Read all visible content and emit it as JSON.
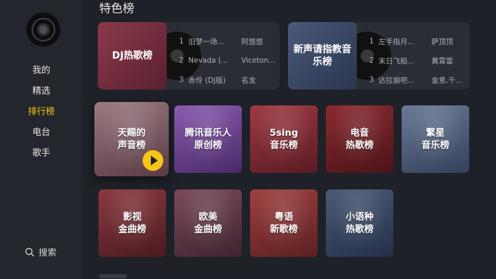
{
  "sidebar": {
    "nav": [
      {
        "label": "我的",
        "active": false
      },
      {
        "label": "精选",
        "active": false
      },
      {
        "label": "排行榜",
        "active": true
      },
      {
        "label": "电台",
        "active": false
      },
      {
        "label": "歌手",
        "active": false
      }
    ],
    "search_label": "搜索"
  },
  "main": {
    "section_title": "特色榜",
    "wide_cards": [
      {
        "title": "DJ热歌榜",
        "rows": [
          {
            "rank": "1",
            "song": "旧梦一场...",
            "artist": "阿悠悠"
          },
          {
            "rank": "2",
            "song": "Nevada (...",
            "artist": "Viceton..."
          },
          {
            "rank": "3",
            "song": "赤伶 (DJ版)",
            "artist": "名龙"
          }
        ]
      },
      {
        "title": "新声请指教音乐榜",
        "rows": [
          {
            "rank": "1",
            "song": "左手指月...",
            "artist": "萨顶顶"
          },
          {
            "rank": "2",
            "song": "末日飞船...",
            "artist": "黄霄雲"
          },
          {
            "rank": "3",
            "song": "达拉崩吧...",
            "artist": "金意,千..."
          }
        ]
      }
    ],
    "tiles_row1": [
      {
        "line1": "天赐的",
        "line2": "声音榜",
        "color": "#7a5a62"
      },
      {
        "line1": "腾讯音乐人",
        "line2": "原创榜",
        "color": "#6a4a8a"
      },
      {
        "line1": "5sing",
        "line2": "音乐榜",
        "color": "#7a2a34"
      },
      {
        "line1": "电音",
        "line2": "热歌榜",
        "color": "#6a2228"
      },
      {
        "line1": "繁星",
        "line2": "音乐榜",
        "color": "#4a5a74"
      }
    ],
    "tiles_row2": [
      {
        "line1": "影视",
        "line2": "金曲榜",
        "color": "#6a2a30"
      },
      {
        "line1": "欧美",
        "line2": "金曲榜",
        "color": "#5a3a4a"
      },
      {
        "line1": "粤语",
        "line2": "新歌榜",
        "color": "#7a2e2e"
      },
      {
        "line1": "小语种",
        "line2": "热歌榜",
        "color": "#3a4a60"
      }
    ]
  }
}
